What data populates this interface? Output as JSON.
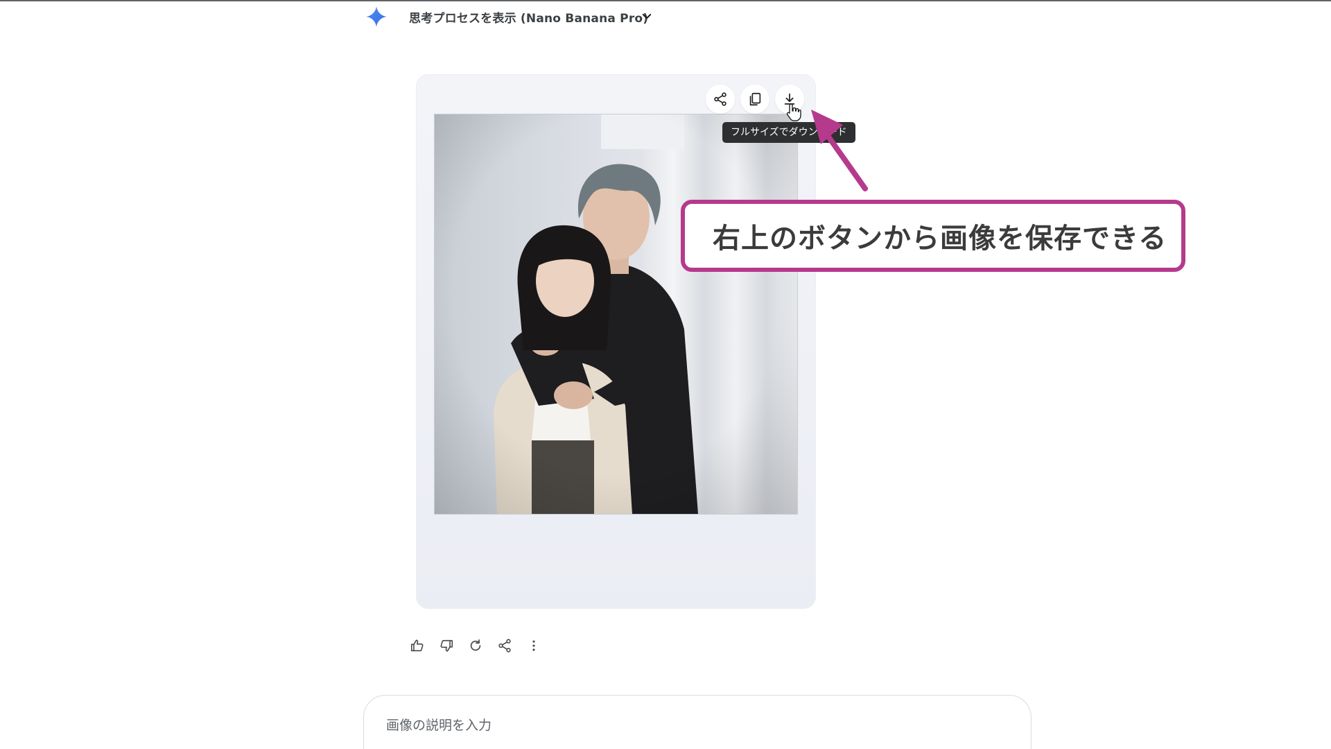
{
  "thinking": {
    "label": "思考プロセスを表示 (Nano Banana Pro)",
    "icon": "gemini-spark-icon"
  },
  "image_card": {
    "toolbar": [
      {
        "name": "share",
        "icon": "share-icon"
      },
      {
        "name": "copy",
        "icon": "copy-icon"
      },
      {
        "name": "download",
        "icon": "download-icon"
      }
    ],
    "tooltip": "フルサイズでダウンロード"
  },
  "annotation": {
    "text": "右上のボタンから画像を保存できる",
    "color": "#b53a8c"
  },
  "actions": [
    {
      "name": "good",
      "icon": "thumbs-up-icon"
    },
    {
      "name": "bad",
      "icon": "thumbs-down-icon"
    },
    {
      "name": "regenerate",
      "icon": "refresh-icon"
    },
    {
      "name": "share",
      "icon": "share-icon"
    },
    {
      "name": "more",
      "icon": "more-vert-icon"
    }
  ],
  "prompt": {
    "placeholder": "画像の説明を入力"
  },
  "colors": {
    "accent_blue": "#4285f4",
    "annotation_magenta": "#b53a8c"
  }
}
